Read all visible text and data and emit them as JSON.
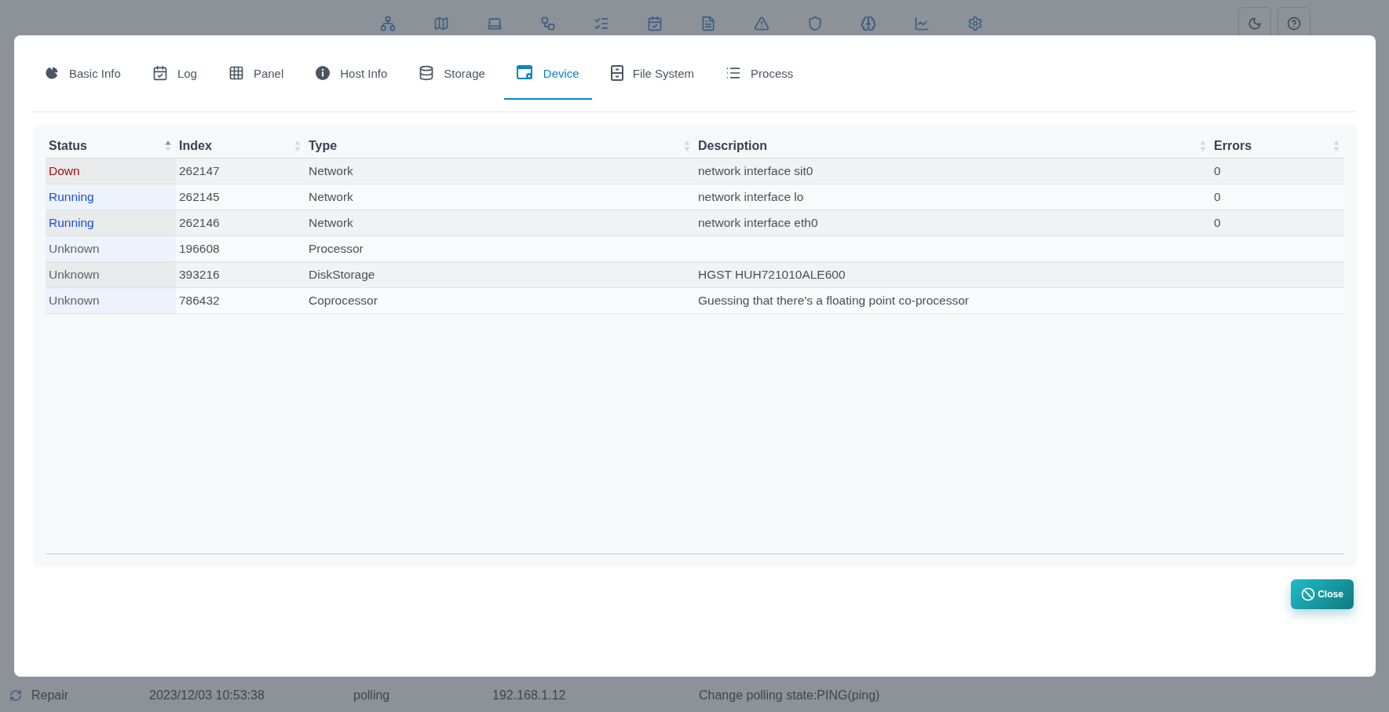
{
  "tabs": [
    {
      "label": "Basic Info",
      "selected": false
    },
    {
      "label": "Log",
      "selected": false
    },
    {
      "label": "Panel",
      "selected": false
    },
    {
      "label": "Host Info",
      "selected": false
    },
    {
      "label": "Storage",
      "selected": false
    },
    {
      "label": "Device",
      "selected": true
    },
    {
      "label": "File System",
      "selected": false
    },
    {
      "label": "Process",
      "selected": false
    }
  ],
  "table": {
    "columns": [
      {
        "label": "Status",
        "sorted": true
      },
      {
        "label": "Index",
        "sorted": false
      },
      {
        "label": "Type",
        "sorted": false
      },
      {
        "label": "Description",
        "sorted": false
      },
      {
        "label": "Errors",
        "sorted": false
      }
    ],
    "rows": [
      {
        "status": "Down",
        "kind": "down",
        "index": "262147",
        "type": "Network",
        "description": "network interface sit0",
        "errors": "0"
      },
      {
        "status": "Running",
        "kind": "running",
        "index": "262145",
        "type": "Network",
        "description": "network interface lo",
        "errors": "0"
      },
      {
        "status": "Running",
        "kind": "running",
        "index": "262146",
        "type": "Network",
        "description": "network interface eth0",
        "errors": "0"
      },
      {
        "status": "Unknown",
        "kind": "unknown",
        "index": "196608",
        "type": "Processor"
      },
      {
        "status": "Unknown",
        "kind": "unknown",
        "index": "393216",
        "type": "DiskStorage",
        "description": "HGST HUH721010ALE600"
      },
      {
        "status": "Unknown",
        "kind": "unknown",
        "index": "786432",
        "type": "Coprocessor",
        "description": "Guessing that there's a floating point co-processor"
      }
    ]
  },
  "close_button": {
    "label": "Close"
  },
  "background_log_row": {
    "cells": [
      "Repair",
      "2023/12/03 10:53:38",
      "polling",
      "192.168.1.12",
      "Change polling state:PING(ping)"
    ]
  }
}
